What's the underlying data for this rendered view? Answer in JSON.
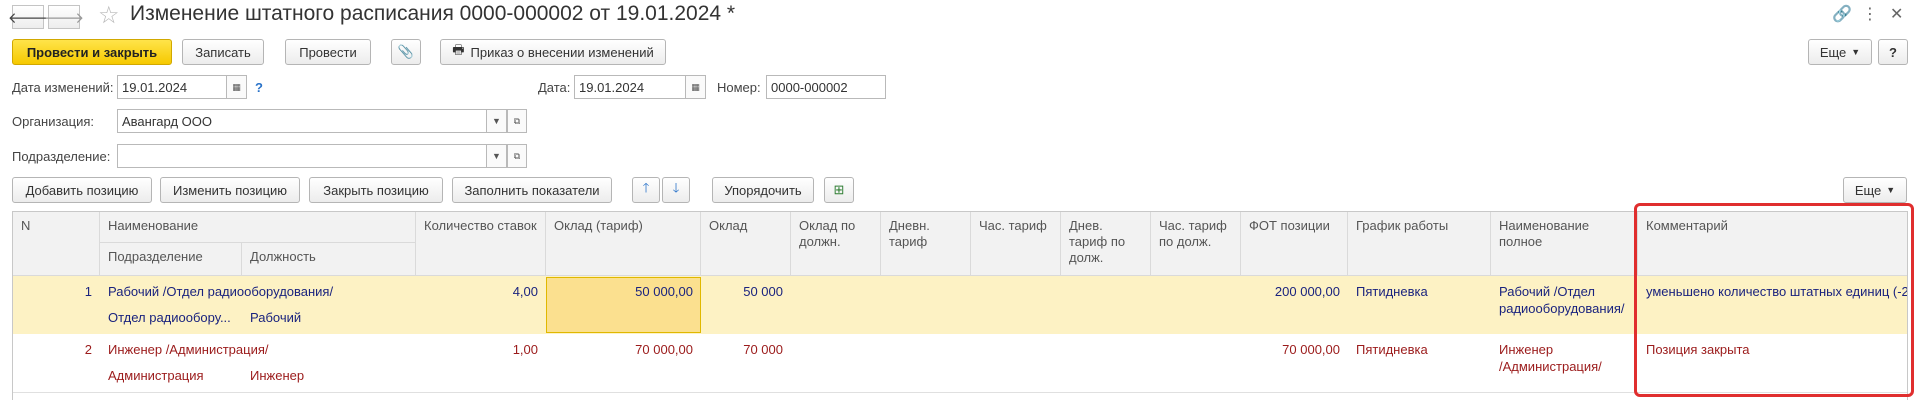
{
  "window": {
    "title": "Изменение штатного расписания 0000-000002 от 19.01.2024 *",
    "back_icon": "arrow-left-icon",
    "forward_icon": "arrow-right-icon",
    "link_icon": "link-icon",
    "more_icon": "vertical-dots-icon",
    "close_icon": "close-icon"
  },
  "toolbar": {
    "post_close": "Провести и закрыть",
    "save": "Записать",
    "post": "Провести",
    "print_order": "Приказ о внесении изменений",
    "more": "Еще",
    "help": "?"
  },
  "form": {
    "change_date_label": "Дата изменений:",
    "change_date_value": "19.01.2024",
    "help_mark": "?",
    "date_label": "Дата:",
    "date_value": "19.01.2024",
    "number_label": "Номер:",
    "number_value": "0000-000002",
    "org_label": "Организация:",
    "org_value": "Авангард ООО",
    "dept_label": "Подразделение:",
    "dept_value": ""
  },
  "table_toolbar": {
    "add_position": "Добавить позицию",
    "edit_position": "Изменить позицию",
    "close_position": "Закрыть позицию",
    "fill_indicators": "Заполнить показатели",
    "sort": "Упорядочить",
    "more": "Еще"
  },
  "table": {
    "headers": {
      "n": "N",
      "name": "Наименование",
      "department": "Подразделение",
      "position": "Должность",
      "rate_count": "Количество ставок",
      "salary_tariff": "Оклад (тариф)",
      "salary": "Оклад",
      "salary_by_pos": "Оклад по должн.",
      "daily_tariff": "Дневн. тариф",
      "hourly_tariff": "Час. тариф",
      "daily_tariff_pos": "Днев. тариф по долж.",
      "hourly_tariff_pos": "Час. тариф по долж.",
      "payroll": "ФОТ позиции",
      "schedule": "График работы",
      "full_name": "Наименование полное",
      "comment": "Комментарий"
    },
    "rows": [
      {
        "n": "1",
        "name": "Рабочий /Отдел радиооборудования/",
        "department": "Отдел радиообору...",
        "position": "Рабочий",
        "rate_count": "4,00",
        "salary_tariff": "50 000,00",
        "salary": "50 000",
        "payroll": "200 000,00",
        "schedule": "Пятидневка",
        "full_name_1": "Рабочий /Отдел",
        "full_name_2": "радиооборудования/",
        "comment": "уменьшено количество штатных единиц (-2"
      },
      {
        "n": "2",
        "name": "Инженер /Администрация/",
        "department": "Администрация",
        "position": "Инженер",
        "rate_count": "1,00",
        "salary_tariff": "70 000,00",
        "salary": "70 000",
        "payroll": "70 000,00",
        "schedule": "Пятидневка",
        "full_name_1": "Инженер",
        "full_name_2": "/Администрация/",
        "comment": "Позиция закрыта"
      }
    ]
  },
  "colors": {
    "primary_button": "#f6c900",
    "selected_row": "#fdf2c4",
    "closed_row_text": "#9b1b1b",
    "annotation": "#e02e2e"
  }
}
